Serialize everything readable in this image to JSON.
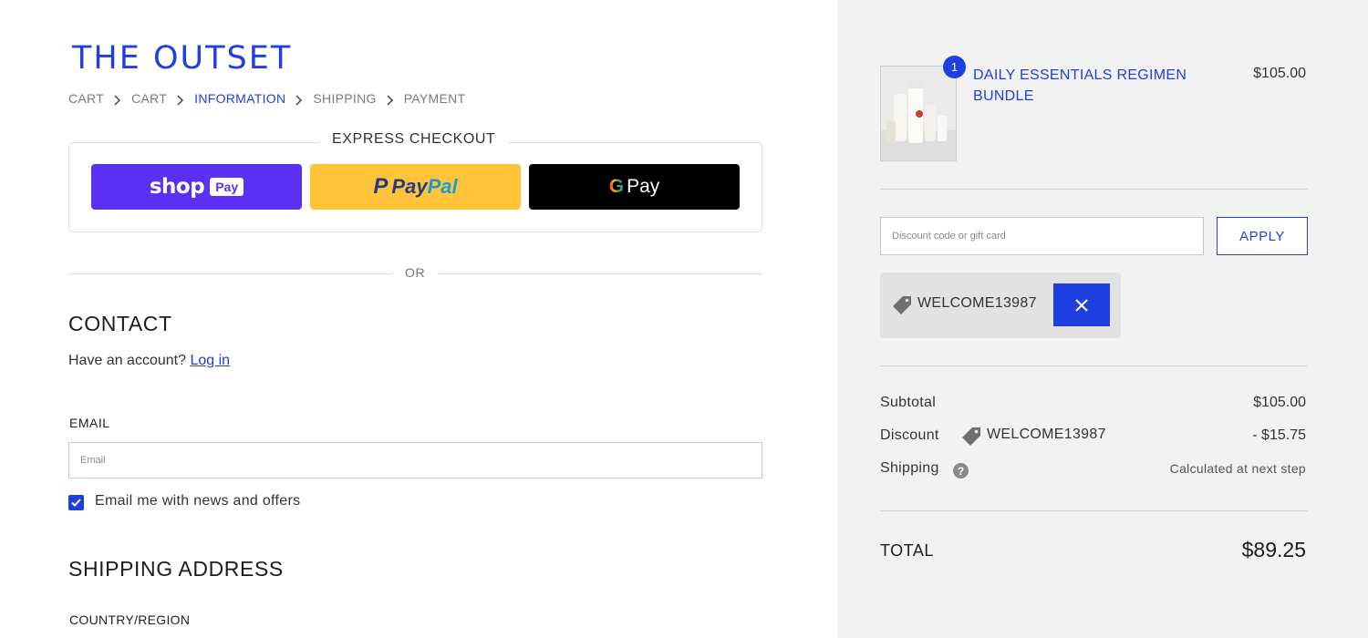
{
  "brand": "THE OUTSET",
  "breadcrumbs": [
    {
      "label": "CART",
      "state": "link"
    },
    {
      "label": "CART",
      "state": "link"
    },
    {
      "label": "INFORMATION",
      "state": "current"
    },
    {
      "label": "SHIPPING",
      "state": "upcoming"
    },
    {
      "label": "PAYMENT",
      "state": "upcoming"
    }
  ],
  "express": {
    "title": "EXPRESS CHECKOUT",
    "shop_pay": {
      "word": "shop",
      "tag": "Pay"
    },
    "paypal": {
      "pay": "Pay",
      "pal": "Pal"
    },
    "gpay": {
      "g": "G",
      "pay": "Pay"
    }
  },
  "divider_text": "OR",
  "contact": {
    "heading": "CONTACT",
    "account_prompt": "Have an account?",
    "login_link": "Log in",
    "email_label": "EMAIL",
    "email_placeholder": "Email",
    "email_value": "",
    "newsletter_label": "Email me with news and offers",
    "newsletter_checked": true
  },
  "shipping": {
    "heading": "SHIPPING ADDRESS",
    "country_label": "COUNTRY/REGION"
  },
  "summary": {
    "item": {
      "name": "DAILY ESSENTIALS REGIMEN BUNDLE",
      "price": "$105.00",
      "quantity": "1"
    },
    "discount_placeholder": "Discount code or gift card",
    "discount_value": "",
    "apply_label": "APPLY",
    "applied_code": "WELCOME13987",
    "subtotal_label": "Subtotal",
    "subtotal_value": "$105.00",
    "discount_label": "Discount",
    "discount_code": "WELCOME13987",
    "discount_amount": "- $15.75",
    "shipping_label": "Shipping",
    "shipping_note": "Calculated at next step",
    "total_label": "TOTAL",
    "total_value": "$89.25"
  },
  "colors": {
    "accent": "#1f3fe0",
    "shop_pay": "#5a31f4",
    "paypal": "#ffc439",
    "gpay": "#000000",
    "summary_bg": "#f2f2f2"
  }
}
